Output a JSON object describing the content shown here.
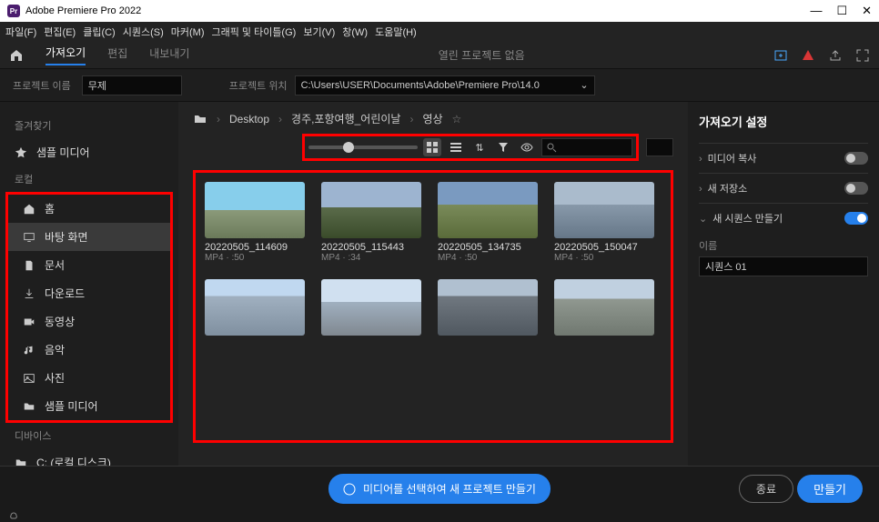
{
  "titlebar": {
    "title": "Adobe Premiere Pro 2022",
    "logo": "Pr"
  },
  "menubar": [
    "파일(F)",
    "편집(E)",
    "클립(C)",
    "시퀀스(S)",
    "마커(M)",
    "그래픽 및 타이틀(G)",
    "보기(V)",
    "창(W)",
    "도움말(H)"
  ],
  "tabs": {
    "import": "가져오기",
    "edit": "편집",
    "export": "내보내기",
    "center": "열린 프로젝트 없음"
  },
  "project": {
    "name_label": "프로젝트 이름",
    "name_value": "무제",
    "path_label": "프로젝트 위치",
    "path_value": "C:\\Users\\USER\\Documents\\Adobe\\Premiere Pro\\14.0"
  },
  "sidebar": {
    "favorites_label": "즐겨찾기",
    "favorites": [
      "샘플 미디어"
    ],
    "local_label": "로컬",
    "local": [
      "홈",
      "바탕 화면",
      "문서",
      "다운로드",
      "동영상",
      "음악",
      "사진",
      "샘플 미디어"
    ],
    "devices_label": "디바이스",
    "devices": [
      "C: (로컬 디스크)"
    ]
  },
  "breadcrumb": [
    "Desktop",
    "경주,포항여행_어린이날",
    "영상"
  ],
  "files": [
    {
      "name": "20220505_114609",
      "meta": "MP4 · :50"
    },
    {
      "name": "20220505_115443",
      "meta": "MP4 · :34"
    },
    {
      "name": "20220505_134735",
      "meta": "MP4 · :50"
    },
    {
      "name": "20220505_150047",
      "meta": "MP4 · :50"
    },
    {
      "name": "",
      "meta": ""
    },
    {
      "name": "",
      "meta": ""
    },
    {
      "name": "",
      "meta": ""
    },
    {
      "name": "",
      "meta": ""
    }
  ],
  "settings": {
    "title": "가져오기 설정",
    "copy_media": "미디어 복사",
    "new_storage": "새 저장소",
    "new_sequence": "새 시퀀스 만들기",
    "name_label": "이름",
    "sequence_name": "시퀀스 01"
  },
  "bottom": {
    "info": "미디어를 선택하여 새 프로젝트 만들기",
    "close": "종료",
    "create": "만들기"
  }
}
